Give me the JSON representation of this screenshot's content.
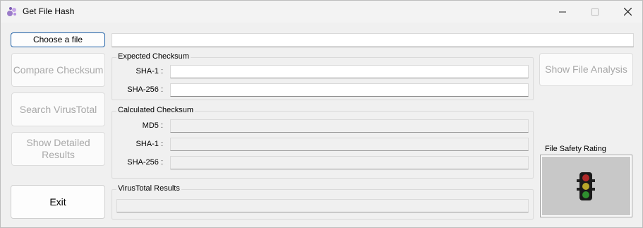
{
  "window": {
    "title": "Get File Hash",
    "minimize": "—",
    "maximize": "☐",
    "close": "✕"
  },
  "file": {
    "choose_label": "Choose a file",
    "path_value": ""
  },
  "left_buttons": {
    "compare": "Compare Checksum",
    "search_vt": "Search VirusTotal",
    "detailed": "Show Detailed Results",
    "exit": "Exit"
  },
  "expected": {
    "title": "Expected Checksum",
    "sha1_label": "SHA-1 :",
    "sha256_label": "SHA-256 :",
    "sha1_value": "",
    "sha256_value": ""
  },
  "calculated": {
    "title": "Calculated Checksum",
    "md5_label": "MD5 :",
    "sha1_label": "SHA-1 :",
    "sha256_label": "SHA-256 :"
  },
  "virustotal": {
    "title": "VirusTotal Results"
  },
  "right": {
    "analysis_label": "Show File Analysis",
    "rating_title": "File Safety Rating"
  },
  "colors": {
    "accent": "#1d5fa6",
    "disabled_text": "#a8a8a8"
  }
}
